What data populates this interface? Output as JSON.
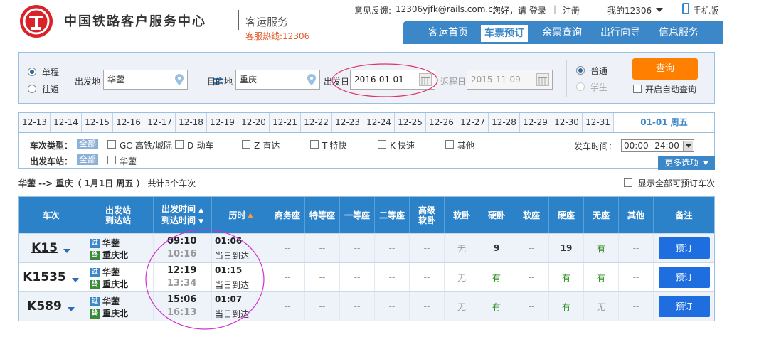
{
  "header": {
    "site_title": "中国铁路客户服务中心",
    "sub_title": "客运服务",
    "hotline": "客服热线:12306",
    "feedback_label": "意见反馈:",
    "feedback_email": "12306yjfk@rails.com.cn",
    "greeting": "您好，请",
    "login": "登录",
    "divider": "|",
    "register": "注册",
    "my12306": "我的12306",
    "mobile": "手机版"
  },
  "nav": [
    "客运首页",
    "车票预订",
    "余票查询",
    "出行向导",
    "信息服务"
  ],
  "search": {
    "oneway": "单程",
    "roundtrip": "往返",
    "from_label": "出发地",
    "from_value": "华蓥",
    "to_label": "目的地",
    "to_value": "重庆",
    "depart_label": "出发日",
    "depart_value": "2016-01-01",
    "return_label": "返程日",
    "return_value": "2015-11-09",
    "normal": "普通",
    "student": "学生",
    "query": "查询",
    "auto_query": "开启自动查询"
  },
  "dates": [
    "12-13",
    "12-14",
    "12-15",
    "12-16",
    "12-17",
    "12-18",
    "12-19",
    "12-20",
    "12-21",
    "12-22",
    "12-23",
    "12-24",
    "12-25",
    "12-26",
    "12-27",
    "12-28",
    "12-29",
    "12-30",
    "12-31"
  ],
  "active_date": "01-01 周五",
  "filters": {
    "type_label": "车次类型：",
    "all": "全部",
    "types": [
      "GC-高铁/城际",
      "D-动车",
      "Z-直达",
      "T-特快",
      "K-快速",
      "其他"
    ],
    "station_label": "出发车站：",
    "station": "华蓥",
    "time_label": "发车时间：",
    "time_value": "00:00--24:00",
    "more": "更多选项"
  },
  "summary": {
    "route": "华蓥 --> 重庆（ 1月1日  周五 ）",
    "count": "共计3个车次",
    "show_all": "显示全部可预订车次"
  },
  "table": {
    "headers": {
      "train": "车次",
      "station_top": "出发站",
      "station_bottom": "到达站",
      "time_top": "出发时间",
      "time_bottom": "到达时间",
      "duration": "历时",
      "business": "商务座",
      "special": "特等座",
      "first": "一等座",
      "second": "二等座",
      "senior_top": "高级",
      "senior_bottom": "软卧",
      "soft_sleeper": "软卧",
      "hard_sleeper": "硬卧",
      "soft_seat": "软座",
      "hard_seat": "硬座",
      "no_seat": "无座",
      "other": "其他",
      "remark": "备注"
    },
    "rows": [
      {
        "train": "K15",
        "from_tag": "过",
        "from": "华蓥",
        "to_tag": "终",
        "to": "重庆北",
        "depart": "09:10",
        "arrive": "10:16",
        "duration": "01:06",
        "arrive_day": "当日到达",
        "seats": [
          "--",
          "--",
          "--",
          "--",
          "--",
          "无",
          "9",
          "--",
          "19",
          "有",
          "--"
        ],
        "book": "预订"
      },
      {
        "train": "K1535",
        "from_tag": "过",
        "from": "华蓥",
        "to_tag": "终",
        "to": "重庆北",
        "depart": "12:19",
        "arrive": "13:34",
        "duration": "01:15",
        "arrive_day": "当日到达",
        "seats": [
          "--",
          "--",
          "--",
          "--",
          "--",
          "无",
          "有",
          "--",
          "有",
          "有",
          "--"
        ],
        "book": "预订"
      },
      {
        "train": "K589",
        "from_tag": "过",
        "from": "华蓥",
        "to_tag": "终",
        "to": "重庆北",
        "depart": "15:06",
        "arrive": "16:13",
        "duration": "01:07",
        "arrive_day": "当日到达",
        "seats": [
          "--",
          "--",
          "--",
          "--",
          "--",
          "无",
          "有",
          "--",
          "有",
          "无",
          "--"
        ],
        "book": "预订"
      }
    ]
  },
  "colors": {
    "brand": "#3b87c8",
    "accent": "#ff7f00",
    "available": "#2b8a1f",
    "annotation": "#e0306a"
  }
}
